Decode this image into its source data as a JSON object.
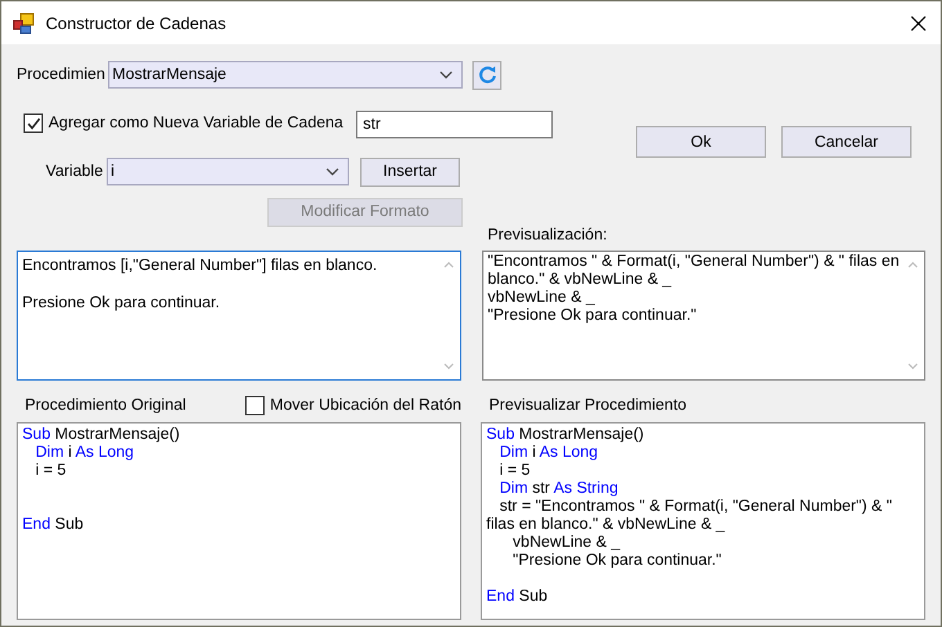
{
  "window": {
    "title": "Constructor de Cadenas"
  },
  "procedure": {
    "label": "Procedimien",
    "value": "MostrarMensaje"
  },
  "add_variable": {
    "label": "Agregar como Nueva Variable de Cadena",
    "checked": true,
    "value": "str"
  },
  "buttons": [
    {
      "label": "Ok"
    },
    {
      "label": "Cancelar"
    }
  ],
  "variable": {
    "label": "Variable",
    "value": "i"
  },
  "insert_button": {
    "label": "Insertar"
  },
  "format_button": {
    "label": "Modificar Formato",
    "disabled": true
  },
  "message": {
    "paragraphs": [
      "Encontramos [i,\"General Number\"] filas en blanco.",
      "Presione Ok para continuar."
    ]
  },
  "preview": {
    "label": "Previsualización:",
    "lines": [
      "\"Encontramos \" & Format(i, \"General Number\") & \" filas en blanco.\" & vbNewLine & _",
      "vbNewLine & _",
      "\"Presione Ok para continuar.\""
    ]
  },
  "original_procedure": {
    "label": "Procedimiento Original",
    "lines": [
      {
        "kind": "code",
        "segments": [
          {
            "text": "Sub",
            "kind": "keyword"
          },
          {
            "text": " MostrarMensaje()",
            "kind": "plain"
          }
        ]
      },
      {
        "kind": "code",
        "segments": [
          {
            "text": "   Dim",
            "kind": "keyword"
          },
          {
            "text": " i ",
            "kind": "plain"
          },
          {
            "text": "As Long",
            "kind": "keyword"
          }
        ]
      },
      {
        "kind": "code",
        "segments": [
          {
            "text": "   i = 5",
            "kind": "plain"
          }
        ]
      },
      {
        "kind": "blank"
      },
      {
        "kind": "blank"
      },
      {
        "kind": "code",
        "segments": [
          {
            "text": "End",
            "kind": "keyword"
          },
          {
            "text": " Sub",
            "kind": "plain"
          }
        ]
      }
    ]
  },
  "mouse_option": {
    "label": "Mover Ubicación del Ratón",
    "checked": false
  },
  "preview_procedure": {
    "label": "Previsualizar Procedimiento",
    "lines": [
      {
        "kind": "code",
        "segments": [
          {
            "text": "Sub",
            "kind": "keyword"
          },
          {
            "text": " MostrarMensaje()",
            "kind": "plain"
          }
        ]
      },
      {
        "kind": "code",
        "segments": [
          {
            "text": "   Dim",
            "kind": "keyword"
          },
          {
            "text": " i ",
            "kind": "plain"
          },
          {
            "text": "As Long",
            "kind": "keyword"
          }
        ]
      },
      {
        "kind": "code",
        "segments": [
          {
            "text": "   i = 5",
            "kind": "plain"
          }
        ]
      },
      {
        "kind": "code",
        "segments": [
          {
            "text": "   Dim",
            "kind": "keyword"
          },
          {
            "text": " str ",
            "kind": "plain"
          },
          {
            "text": "As String",
            "kind": "keyword"
          }
        ]
      },
      {
        "kind": "code",
        "segments": [
          {
            "text": "   str = \"Encontramos \" & Format(i, \"General Number\") & \" filas en blanco.\" & vbNewLine & _",
            "kind": "plain"
          }
        ]
      },
      {
        "kind": "code",
        "segments": [
          {
            "text": "      vbNewLine & _",
            "kind": "plain"
          }
        ]
      },
      {
        "kind": "code",
        "segments": [
          {
            "text": "      \"Presione Ok para continuar.\"",
            "kind": "plain"
          }
        ]
      },
      {
        "kind": "blank"
      },
      {
        "kind": "code",
        "segments": [
          {
            "text": "End",
            "kind": "keyword"
          },
          {
            "text": " Sub",
            "kind": "plain"
          }
        ]
      }
    ]
  }
}
